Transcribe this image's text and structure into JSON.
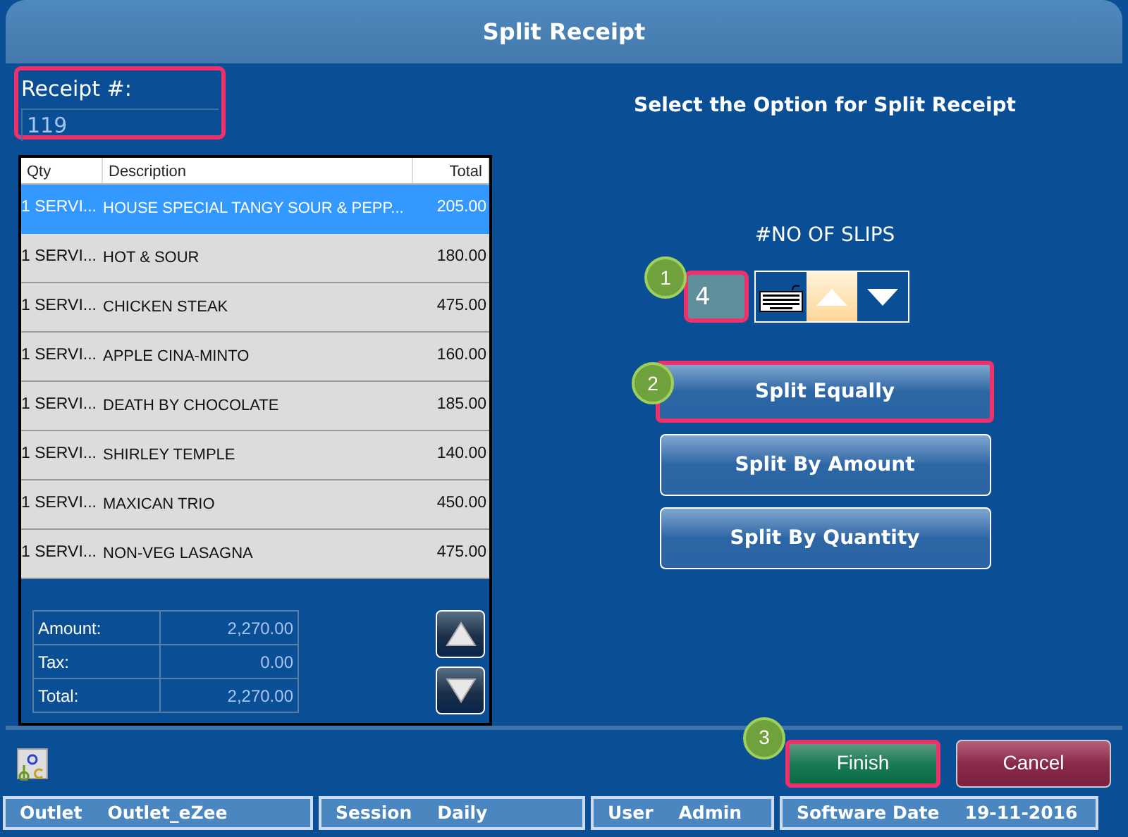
{
  "window": {
    "title": "Split Receipt"
  },
  "receipt": {
    "label": "Receipt #:",
    "value": "119",
    "highlighted": true
  },
  "table": {
    "columns": [
      "Qty",
      "Description",
      "Total"
    ],
    "rows": [
      {
        "qty": "1 SERVI...",
        "description": "HOUSE SPECIAL TANGY SOUR & PEPP...",
        "total": "205.00",
        "selected": true
      },
      {
        "qty": "1 SERVI...",
        "description": "HOT & SOUR",
        "total": "180.00",
        "selected": false
      },
      {
        "qty": "1 SERVI...",
        "description": "CHICKEN STEAK",
        "total": "475.00",
        "selected": false
      },
      {
        "qty": "1 SERVI...",
        "description": "APPLE  CINA-MINTO",
        "total": "160.00",
        "selected": false
      },
      {
        "qty": "1 SERVI...",
        "description": "DEATH BY CHOCOLATE",
        "total": "185.00",
        "selected": false
      },
      {
        "qty": "1 SERVI...",
        "description": "SHIRLEY TEMPLE",
        "total": "140.00",
        "selected": false
      },
      {
        "qty": "1 SERVI...",
        "description": "MAXICAN TRIO",
        "total": "450.00",
        "selected": false
      },
      {
        "qty": "1 SERVI...",
        "description": "NON-VEG LASAGNA",
        "total": "475.00",
        "selected": false
      }
    ]
  },
  "totals": [
    {
      "label": "Amount:",
      "value": "2,270.00"
    },
    {
      "label": "Tax:",
      "value": "0.00"
    },
    {
      "label": "Total:",
      "value": "2,270.00"
    }
  ],
  "split": {
    "title": "Select the Option for Split Receipt",
    "slips_label": "#NO OF SLIPS",
    "slips_value": "4",
    "slips_highlighted": true,
    "slips_callout": "1",
    "options": [
      {
        "label": "Split Equally",
        "highlighted": true,
        "callout": "2"
      },
      {
        "label": "Split By Amount",
        "highlighted": false
      },
      {
        "label": "Split By Quantity",
        "highlighted": false
      }
    ]
  },
  "actions": [
    {
      "label": "Finish",
      "kind": "confirm",
      "highlighted": true,
      "callout": "3"
    },
    {
      "label": "Cancel",
      "kind": "cancel",
      "highlighted": false
    }
  ],
  "status_bar": [
    {
      "label": "Outlet",
      "value": "Outlet_eZee"
    },
    {
      "label": "Session",
      "value": "Daily"
    },
    {
      "label": "User",
      "value": "Admin"
    },
    {
      "label": "Software Date",
      "value": "19-11-2016"
    }
  ]
}
